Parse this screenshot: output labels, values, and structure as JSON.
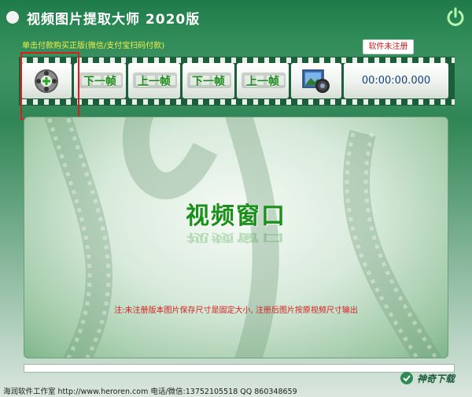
{
  "window": {
    "title": "视频图片提取大师  2020版"
  },
  "header": {
    "promo_text": "单击付款购买正版(微信/支付宝扫码付款)",
    "unregistered_badge": "软件未注册"
  },
  "toolbar": {
    "add_video_icon": "add-film-reel-icon",
    "buttons": [
      {
        "label": "下一帧"
      },
      {
        "label": "上一帧"
      },
      {
        "label": "下一帧"
      },
      {
        "label": "上一帧"
      }
    ],
    "snapshot_icon": "camera-photo-icon",
    "timecode": "00:00:00.000"
  },
  "video_panel": {
    "placeholder_title": "视频窗口",
    "note": "注:未注册版本图片保存尺寸是固定大小, 注册后图片按原视频尺寸输出"
  },
  "progress": {
    "value": 0
  },
  "statusbar": {
    "text": "海润软件工作室  http://www.heroren.com  电话/微信:13752105518  QQ 860348659"
  },
  "watermark": {
    "text": "神奇下载"
  },
  "colors": {
    "accent": "#2d8a55",
    "highlight": "#dc1d1d",
    "button_text": "#1b8a1b"
  }
}
